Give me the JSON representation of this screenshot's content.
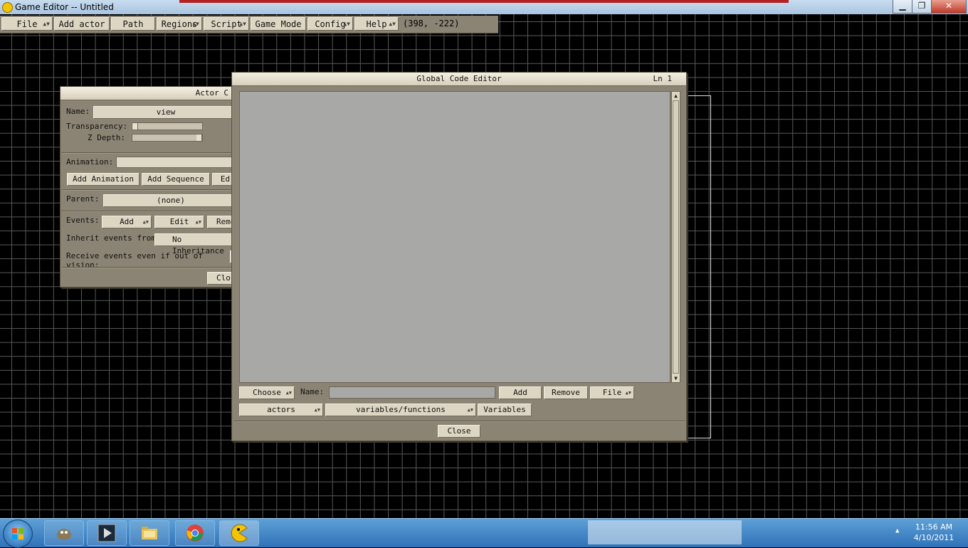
{
  "window": {
    "title": "Game Editor -- Untitled"
  },
  "menubar": {
    "items": [
      {
        "label": "File"
      },
      {
        "label": "Add actor"
      },
      {
        "label": "Path"
      },
      {
        "label": "Regions"
      },
      {
        "label": "Script"
      },
      {
        "label": "Game Mode"
      },
      {
        "label": "Config"
      },
      {
        "label": "Help"
      }
    ],
    "coordinates": "(398, -222)"
  },
  "actor_control": {
    "title": "Actor C",
    "name_label": "Name:",
    "name_value": "view",
    "transparency_label": "Transparency:",
    "zdepth_label": "Z Depth:",
    "animation_label": "Animation:",
    "add_animation": "Add Animation",
    "add_sequence": "Add Sequence",
    "edit_partial": "Ed",
    "parent_label": "Parent:",
    "parent_value": "(none)",
    "events_label": "Events:",
    "events_add": "Add",
    "events_edit": "Edit",
    "events_remove_partial": "Remo",
    "inherit_label": "Inherit events from:",
    "inherit_value": "No Inheritance",
    "receive_label": "Receive events even if out of vision:",
    "close_partial": "Clo"
  },
  "code_editor": {
    "title": "Global Code Editor",
    "line_indicator": "Ln 1",
    "choose": "Choose",
    "name_label": "Name:",
    "add": "Add",
    "remove": "Remove",
    "file": "File",
    "actors": "actors",
    "varfunc": "variables/functions",
    "variables": "Variables",
    "close": "Close"
  },
  "taskbar": {
    "time": "11:56 AM",
    "date": "4/10/2011"
  }
}
